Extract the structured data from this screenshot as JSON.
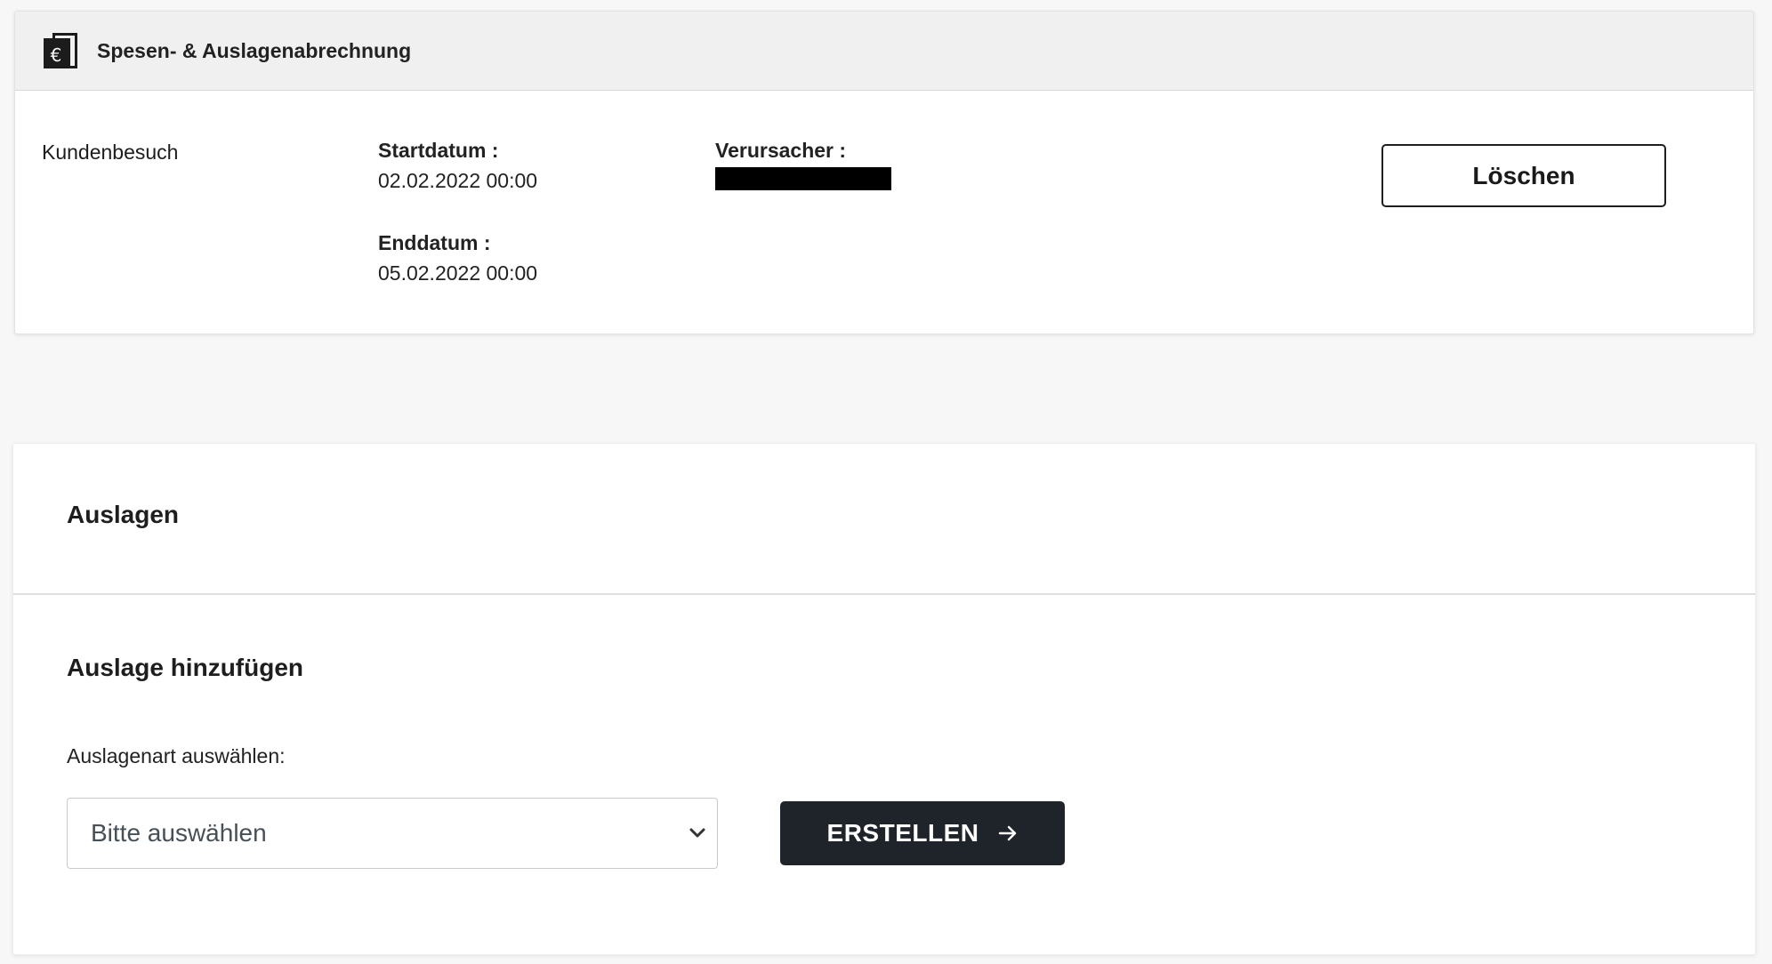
{
  "report": {
    "title": "Spesen- & Auslagenabrechnung",
    "icon": "euro-document-icon",
    "trip_type": "Kundenbesuch",
    "start_label": "Startdatum :",
    "start_value": "02.02.2022 00:00",
    "end_label": "Enddatum :",
    "end_value": "05.02.2022 00:00",
    "causer_label": "Verursacher :",
    "causer_value_redacted": true,
    "delete_label": "Löschen"
  },
  "expenses": {
    "title": "Auslagen",
    "add_title": "Auslage hinzufügen",
    "select_label": "Auslagenart auswählen:",
    "select_value": "Bitte auswählen",
    "create_label": "ERSTELLEN"
  },
  "colors": {
    "background": "#f7f7f7",
    "header_bg": "#f0f0f0",
    "primary_button": "#1f232a",
    "redaction": "#000000"
  }
}
